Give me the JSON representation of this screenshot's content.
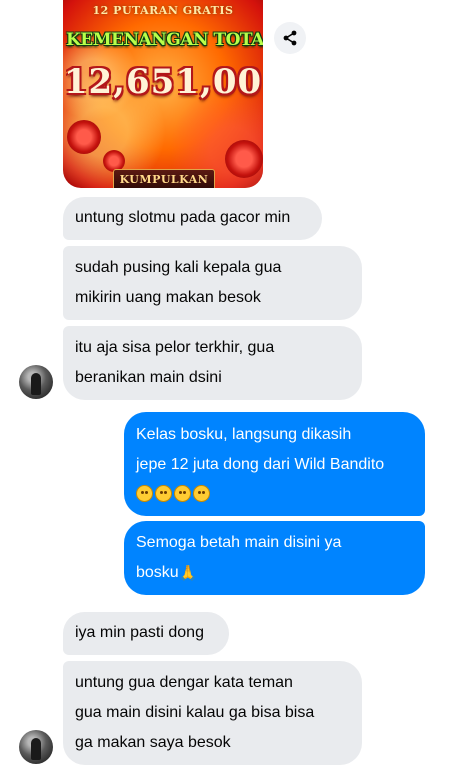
{
  "promo": {
    "top_text": "12 PUTARAN GRATIS",
    "title": "KEMENANGAN TOTAL",
    "amount": "12,651,00",
    "button_label": "KUMPULKAN"
  },
  "share": {
    "icon": "share-icon"
  },
  "messages": [
    {
      "from": "them",
      "lines": [
        "untung slotmu pada gacor min"
      ]
    },
    {
      "from": "them",
      "lines": [
        "sudah pusing kali kepala gua",
        "mikirin uang makan besok"
      ]
    },
    {
      "from": "them",
      "lines": [
        "itu aja sisa pelor terkhir, gua",
        "beranikan main dsini"
      ]
    },
    {
      "from": "me",
      "lines": [
        "Kelas bosku, langsung dikasih",
        "jepe 12 juta dong dari Wild Bandito"
      ],
      "emoji": [
        "grin",
        "grin",
        "grin",
        "grin"
      ]
    },
    {
      "from": "me",
      "lines": [
        "Semoga betah main disini ya",
        "bosku"
      ],
      "emoji_trailing": "pray"
    },
    {
      "from": "them",
      "lines": [
        "iya min pasti dong"
      ]
    },
    {
      "from": "them",
      "lines": [
        "untung gua dengar kata teman",
        "gua main disini kalau ga bisa bisa",
        "ga makan saya besok"
      ]
    }
  ],
  "colors": {
    "incoming_bubble": "#e9ebee",
    "outgoing_bubble": "#0084ff",
    "outgoing_text": "#ffffff"
  }
}
